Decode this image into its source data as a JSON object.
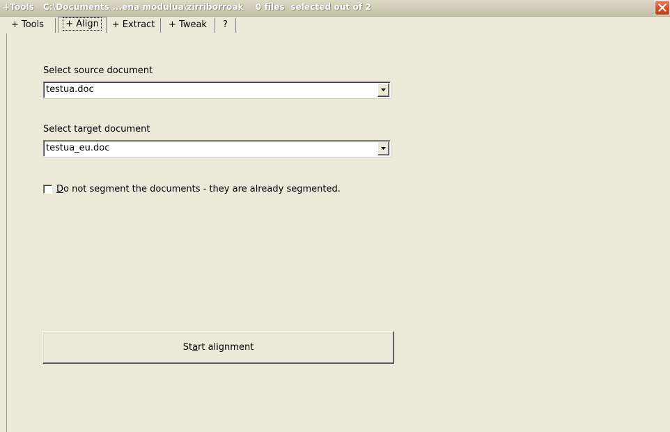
{
  "window": {
    "title": "+Tools   C:\\Documents ...ena modulua\\zirriborroak    0 files  selected out of 2"
  },
  "tabs": [
    {
      "label": "+ Tools"
    },
    {
      "label": "+ Align"
    },
    {
      "label": "+ Extract"
    },
    {
      "label": "+ Tweak"
    },
    {
      "label": "?"
    }
  ],
  "active_tab": "+ Align",
  "form": {
    "source_label": "Select source document",
    "source_value": "testua.doc",
    "target_label": "Select target document",
    "target_value": "testua_eu.doc",
    "checkbox": {
      "mnemonic": "D",
      "label_rest": "o not segment the documents - they are already segmented.",
      "checked": false
    },
    "start_button": {
      "pre": "St",
      "mnemonic": "a",
      "post": "rt alignment"
    }
  },
  "icons": {
    "close": "close-icon",
    "dropdown": "chevron-down-icon"
  },
  "colors": {
    "background": "#ece9d8",
    "close_button": "#d8522b"
  }
}
